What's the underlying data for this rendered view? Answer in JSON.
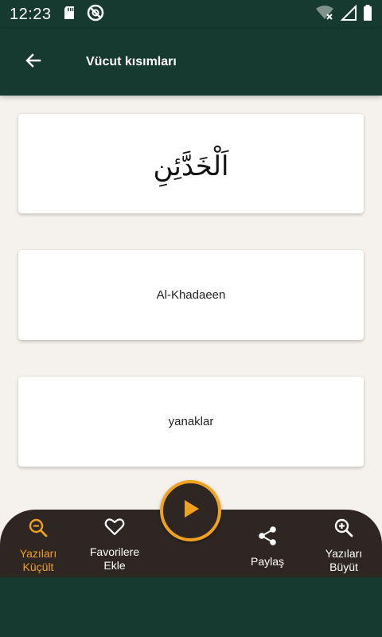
{
  "status_bar": {
    "time": "12:23",
    "icons": [
      "sd-card-icon",
      "no-disturb-icon",
      "wifi-off-icon",
      "signal-icon",
      "battery-icon"
    ]
  },
  "app_bar": {
    "title": "Vücut kısımları",
    "back_icon": "arrow-back-icon"
  },
  "cards": {
    "arabic": "اَلْخَدَّئِنِ",
    "transliteration": "Al-Khadaeen",
    "meaning": "yanaklar"
  },
  "bottom_nav": {
    "shrink_label": "Yazıları\nKüçült",
    "favorite_label": "Favorilere\nEkle",
    "share_label": "Paylaş",
    "enlarge_label": "Yazıları\nBüyüt",
    "play_icon": "play-icon"
  },
  "colors": {
    "primary": "#163a30",
    "background": "#f5f1ec",
    "accent": "#f0a11f",
    "nav_background": "#2e2623",
    "card": "#ffffff"
  }
}
